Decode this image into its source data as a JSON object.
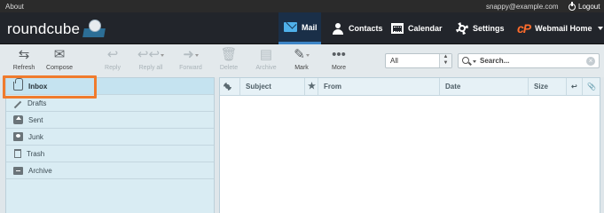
{
  "topbar": {
    "about": "About",
    "user": "snappy@example.com",
    "logout": "Logout"
  },
  "brand": {
    "logo_text": "roundcube"
  },
  "nav": [
    {
      "label": "Mail",
      "icon": "envelope-icon",
      "active": true
    },
    {
      "label": "Contacts",
      "icon": "person-icon"
    },
    {
      "label": "Calendar",
      "icon": "calendar-icon"
    },
    {
      "label": "Settings",
      "icon": "gear-icon"
    },
    {
      "label": "Webmail Home",
      "icon": "cpanel-icon",
      "icon_text": "cP"
    }
  ],
  "toolbar": {
    "refresh": "Refresh",
    "compose": "Compose",
    "reply": "Reply",
    "reply_all": "Reply all",
    "forward": "Forward",
    "delete": "Delete",
    "archive": "Archive",
    "mark": "Mark",
    "more": "More"
  },
  "filter": {
    "selected": "All"
  },
  "search": {
    "placeholder": "Search..."
  },
  "folders": [
    {
      "label": "Inbox",
      "icon": "inbox-icon",
      "selected": true
    },
    {
      "label": "Drafts",
      "icon": "pencil-icon"
    },
    {
      "label": "Sent",
      "icon": "sent-icon"
    },
    {
      "label": "Junk",
      "icon": "junk-icon"
    },
    {
      "label": "Trash",
      "icon": "trash-icon"
    },
    {
      "label": "Archive",
      "icon": "archive-icon"
    }
  ],
  "columns": {
    "subject": "Subject",
    "from": "From",
    "date": "Date",
    "size": "Size"
  },
  "colors": {
    "accent": "#f07b2d",
    "header": "#22252b",
    "active_nav": "#1a2f48"
  }
}
